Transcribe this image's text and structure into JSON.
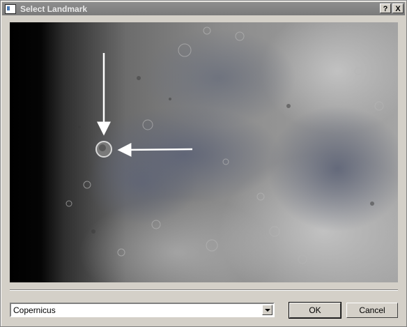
{
  "window": {
    "title": "Select Landmark",
    "help_label": "?",
    "close_label": "X"
  },
  "image": {
    "description_icon": "moon-surface-image"
  },
  "landmark_select": {
    "value": "Copernicus"
  },
  "buttons": {
    "ok_label": "OK",
    "cancel_label": "Cancel"
  },
  "colors": {
    "window_bg": "#d4d0c8",
    "titlebar": "#7f7f7f",
    "arrow": "#ffffff"
  }
}
